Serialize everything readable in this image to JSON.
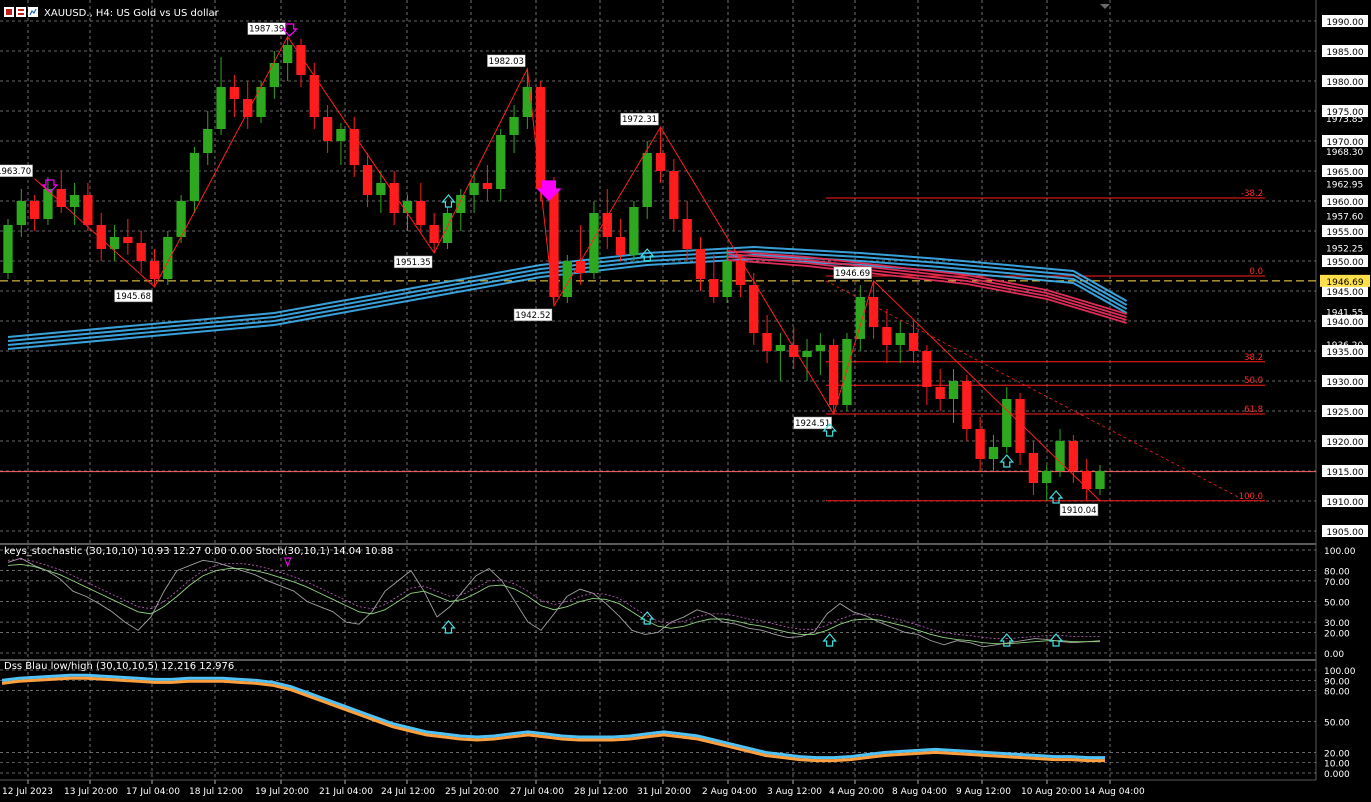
{
  "window": {
    "symbol_title": "XAUUSD., H4:  US Gold vs US dollar",
    "toolbar_icon_names": [
      "chart-grid-icon",
      "chart-table-icon",
      "trade-chart-icon"
    ]
  },
  "colors": {
    "background": "#000000",
    "bull": "#2ea81e",
    "bear": "#ff1c1c",
    "ma_fast": "#3fb3f2",
    "ma_slow": "#dc2c58",
    "grid": "#8a8a8a",
    "current_price_line": "#ff6060",
    "bid_line": "#ffe04a",
    "zigzag": "#ff2020",
    "arrow_down": "#ff00ff",
    "arrow_up": "#40e0e0",
    "fib": "#ff2020",
    "stoch_main": "#a0a0a0",
    "stoch_signal": "#c060c0",
    "keys_line": "#90d080",
    "dss_blue": "#4fc3f7",
    "dss_orange": "#ffa040"
  },
  "price_axis": {
    "labels": [
      "1990.00",
      "1985.00",
      "1980.00",
      "1975.00",
      "1973.85",
      "1970.00",
      "1968.30",
      "1965.00",
      "1962.95",
      "1960.00",
      "1957.60",
      "1955.00",
      "1952.25",
      "1950.00",
      "1945.00",
      "1941.55",
      "1940.00",
      "1936.20",
      "1935.00",
      "1930.00",
      "1925.00",
      "1920.00",
      "1915.00",
      "1910.00",
      "1905.00"
    ],
    "current_price": "1946.69"
  },
  "time_axis": {
    "labels": [
      "12 Jul 2023",
      "13 Jul 20:00",
      "17 Jul 04:00",
      "18 Jul 12:00",
      "19 Jul 20:00",
      "21 Jul 04:00",
      "24 Jul 12:00",
      "25 Jul 20:00",
      "27 Jul 04:00",
      "28 Jul 12:00",
      "31 Jul 20:00",
      "2 Aug 04:00",
      "3 Aug 12:00",
      "4 Aug 20:00",
      "8 Aug 04:00",
      "9 Aug 12:00",
      "10 Aug 20:00",
      "14 Aug 04:00"
    ]
  },
  "swing_labels": [
    "1963.70",
    "1987.39",
    "1945.68",
    "1982.03",
    "1951.35",
    "1942.52",
    "1972.31",
    "1946.69",
    "1924.51",
    "1910.04"
  ],
  "fib_levels": {
    "upper": [
      "-38.2",
      "0.0"
    ],
    "lower": [
      "38.2",
      "50.0",
      "61.8",
      "100.0"
    ]
  },
  "indicator1": {
    "title": "keys_stochastic (30,10,10) 10.93 12.27 0.00 0.00 Stoch(30,10,1) 14.04 10.88",
    "scale": [
      "100.00",
      "80.00",
      "70.00",
      "50.00",
      "30.00",
      "20.00",
      "0.00"
    ]
  },
  "indicator2": {
    "title": "Dss Blau low/high (30,10,10,5) 12.216 12.976",
    "scale": [
      "100.00",
      "90.00",
      "80.00",
      "50.00",
      "20.00",
      "10.00",
      "0.000"
    ]
  },
  "chart_data": {
    "type": "candlestick",
    "symbol": "XAUUSD.",
    "timeframe": "H4",
    "ylim": [
      1903,
      1993
    ],
    "last_price": 1946.69,
    "current_line": 1914.9,
    "swing_points": [
      {
        "label": "1963.70",
        "value": 1963.7,
        "kind": "high"
      },
      {
        "label": "1987.39",
        "value": 1987.39,
        "kind": "high"
      },
      {
        "label": "1945.68",
        "value": 1945.68,
        "kind": "low"
      },
      {
        "label": "1982.03",
        "value": 1982.03,
        "kind": "high"
      },
      {
        "label": "1951.35",
        "value": 1951.35,
        "kind": "low"
      },
      {
        "label": "1942.52",
        "value": 1942.52,
        "kind": "low"
      },
      {
        "label": "1972.31",
        "value": 1972.31,
        "kind": "high"
      },
      {
        "label": "1946.69",
        "value": 1946.69,
        "kind": "high"
      },
      {
        "label": "1924.51",
        "value": 1924.51,
        "kind": "low"
      },
      {
        "label": "1910.04",
        "value": 1910.04,
        "kind": "low"
      }
    ],
    "candles": [
      [
        1948,
        1957,
        1947,
        1956
      ],
      [
        1956,
        1962,
        1954,
        1960
      ],
      [
        1960,
        1961,
        1955,
        1957
      ],
      [
        1957,
        1964,
        1956,
        1962
      ],
      [
        1962,
        1965,
        1958,
        1959
      ],
      [
        1959,
        1963,
        1956,
        1961
      ],
      [
        1961,
        1963,
        1955,
        1956
      ],
      [
        1956,
        1958,
        1950,
        1952
      ],
      [
        1952,
        1956,
        1950,
        1954
      ],
      [
        1954,
        1957,
        1951,
        1953
      ],
      [
        1953,
        1955,
        1948,
        1950
      ],
      [
        1950,
        1952,
        1945.7,
        1947
      ],
      [
        1947,
        1955,
        1946,
        1954
      ],
      [
        1954,
        1961,
        1953,
        1960
      ],
      [
        1960,
        1969,
        1958,
        1968
      ],
      [
        1968,
        1975,
        1966,
        1972
      ],
      [
        1972,
        1984,
        1971,
        1979
      ],
      [
        1979,
        1981,
        1974,
        1977
      ],
      [
        1977,
        1980,
        1972,
        1974
      ],
      [
        1974,
        1980,
        1973,
        1979
      ],
      [
        1979,
        1985,
        1977,
        1983
      ],
      [
        1983,
        1987.4,
        1980,
        1986
      ],
      [
        1986,
        1987,
        1979,
        1981
      ],
      [
        1981,
        1983,
        1972,
        1974
      ],
      [
        1974,
        1976,
        1968,
        1970
      ],
      [
        1970,
        1973,
        1966,
        1972
      ],
      [
        1972,
        1974,
        1964,
        1966
      ],
      [
        1966,
        1968,
        1959,
        1961
      ],
      [
        1961,
        1965,
        1958,
        1963
      ],
      [
        1963,
        1965,
        1956,
        1958
      ],
      [
        1958,
        1961,
        1955,
        1960
      ],
      [
        1960,
        1963,
        1955,
        1956
      ],
      [
        1956,
        1958,
        1951.4,
        1953
      ],
      [
        1953,
        1959,
        1952,
        1958
      ],
      [
        1958,
        1962,
        1955,
        1961
      ],
      [
        1961,
        1965,
        1958,
        1963
      ],
      [
        1963,
        1966,
        1960,
        1962
      ],
      [
        1962,
        1972,
        1960,
        1971
      ],
      [
        1971,
        1976,
        1968,
        1974
      ],
      [
        1974,
        1982.03,
        1972,
        1979
      ],
      [
        1979,
        1980,
        1960,
        1962
      ],
      [
        1962,
        1964,
        1942.5,
        1944
      ],
      [
        1944,
        1951,
        1943,
        1950
      ],
      [
        1950,
        1956,
        1946,
        1948
      ],
      [
        1948,
        1960,
        1947,
        1958
      ],
      [
        1958,
        1962,
        1952,
        1954
      ],
      [
        1954,
        1957,
        1950,
        1951
      ],
      [
        1951,
        1960,
        1950,
        1959
      ],
      [
        1959,
        1970,
        1957,
        1968
      ],
      [
        1968,
        1972.3,
        1963,
        1965
      ],
      [
        1965,
        1967,
        1955,
        1957
      ],
      [
        1957,
        1960,
        1950,
        1952
      ],
      [
        1952,
        1954,
        1945,
        1947
      ],
      [
        1947,
        1951,
        1943,
        1944
      ],
      [
        1944,
        1952,
        1943,
        1950
      ],
      [
        1950,
        1951,
        1944,
        1946
      ],
      [
        1946,
        1948,
        1936,
        1938
      ],
      [
        1938,
        1941,
        1933,
        1935
      ],
      [
        1935,
        1938,
        1930,
        1936
      ],
      [
        1936,
        1939,
        1932,
        1934
      ],
      [
        1934,
        1937,
        1930,
        1935
      ],
      [
        1935,
        1938,
        1931,
        1936
      ],
      [
        1936,
        1937,
        1924.5,
        1926
      ],
      [
        1926,
        1938,
        1925,
        1937
      ],
      [
        1937,
        1946,
        1935,
        1944
      ],
      [
        1944,
        1946.7,
        1937,
        1939
      ],
      [
        1939,
        1942,
        1933,
        1936
      ],
      [
        1936,
        1940,
        1933,
        1938
      ],
      [
        1938,
        1940,
        1933,
        1935
      ],
      [
        1935,
        1936,
        1926,
        1929
      ],
      [
        1929,
        1932,
        1925,
        1927
      ],
      [
        1927,
        1932,
        1923,
        1930
      ],
      [
        1930,
        1931,
        1920,
        1922
      ],
      [
        1922,
        1924,
        1915,
        1917
      ],
      [
        1917,
        1921,
        1915,
        1919
      ],
      [
        1919,
        1929,
        1918,
        1927
      ],
      [
        1927,
        1928,
        1916,
        1918
      ],
      [
        1918,
        1920,
        1911,
        1913
      ],
      [
        1913,
        1916,
        1910,
        1915
      ],
      [
        1915,
        1922,
        1914,
        1920
      ],
      [
        1920,
        1921,
        1913,
        1915
      ],
      [
        1915,
        1917,
        1910.04,
        1912
      ],
      [
        1912,
        1916,
        1911,
        1915
      ]
    ],
    "ma_fast_points": [
      [
        0,
        1936
      ],
      [
        10,
        1938
      ],
      [
        20,
        1940
      ],
      [
        30,
        1944
      ],
      [
        40,
        1948
      ],
      [
        48,
        1950
      ],
      [
        56,
        1951
      ],
      [
        64,
        1950
      ],
      [
        70,
        1949
      ],
      [
        80,
        1947
      ],
      [
        84,
        1942
      ]
    ],
    "ma_slow_points": [
      [
        54,
        1951
      ],
      [
        60,
        1950
      ],
      [
        66,
        1948.5
      ],
      [
        72,
        1947
      ],
      [
        78,
        1944.5
      ],
      [
        84,
        1940.5
      ]
    ],
    "stochastic": {
      "main": [
        88,
        92,
        85,
        80,
        72,
        60,
        55,
        48,
        40,
        30,
        22,
        35,
        60,
        80,
        85,
        90,
        88,
        84,
        80,
        76,
        70,
        65,
        60,
        50,
        45,
        40,
        30,
        28,
        40,
        60,
        70,
        80,
        60,
        35,
        45,
        60,
        75,
        82,
        70,
        50,
        30,
        22,
        38,
        55,
        62,
        58,
        48,
        36,
        22,
        18,
        20,
        30,
        35,
        42,
        38,
        30,
        28,
        24,
        22,
        18,
        15,
        16,
        20,
        38,
        48,
        40,
        36,
        30,
        25,
        20,
        18,
        12,
        8,
        12,
        10,
        6,
        8,
        10,
        12,
        14,
        13,
        11,
        10,
        11,
        12
      ],
      "signal": [
        85,
        86,
        84,
        80,
        76,
        70,
        64,
        58,
        52,
        46,
        40,
        38,
        45,
        55,
        66,
        75,
        80,
        82,
        82,
        80,
        77,
        73,
        69,
        64,
        58,
        52,
        46,
        40,
        38,
        42,
        50,
        58,
        60,
        55,
        50,
        52,
        58,
        65,
        66,
        62,
        55,
        46,
        42,
        45,
        50,
        53,
        52,
        48,
        40,
        32,
        26,
        24,
        26,
        30,
        33,
        33,
        31,
        28,
        26,
        23,
        20,
        18,
        18,
        22,
        28,
        32,
        33,
        32,
        29,
        26,
        22,
        18,
        15,
        13,
        12,
        10,
        9,
        9,
        10,
        11,
        12,
        12,
        11,
        11,
        11
      ]
    },
    "dss": {
      "values": [
        88,
        90,
        91,
        92,
        93,
        93,
        92,
        91,
        90,
        89,
        89,
        90,
        90,
        90,
        89,
        88,
        86,
        82,
        76,
        70,
        64,
        58,
        52,
        46,
        42,
        38,
        36,
        34,
        33,
        34,
        36,
        38,
        36,
        34,
        33,
        33,
        33,
        34,
        36,
        38,
        36,
        34,
        30,
        26,
        22,
        18,
        16,
        14,
        13,
        13,
        14,
        16,
        18,
        19,
        20,
        21,
        20,
        19,
        18,
        17,
        16,
        15,
        14,
        14,
        13,
        13
      ]
    }
  }
}
